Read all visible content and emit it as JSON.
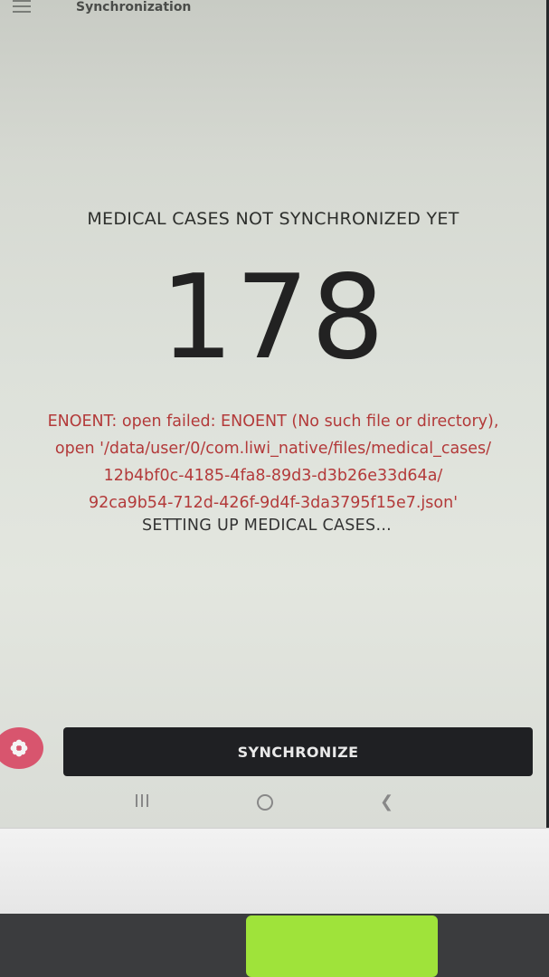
{
  "app_bar": {
    "title": "Synchronization",
    "menu_icon": "hamburger-menu-icon"
  },
  "main": {
    "not_synced_label": "MEDICAL CASES NOT SYNCHRONIZED YET",
    "count": "178",
    "error_lines": [
      "ENOENT: open failed: ENOENT (No such file or directory),",
      "open '/data/user/0/com.liwi_native/files/medical_cases/",
      "12b4bf0c-4185-4fa8-89d3-d3b26e33d64a/",
      "92ca9b54-712d-426f-9d4f-3da3795f15e7.json'"
    ],
    "status": "SETTING UP MEDICAL CASES..."
  },
  "actions": {
    "fab_icon": "flower-icon",
    "sync_label": "SYNCHRONIZE"
  },
  "navbar": {
    "recents_icon": "recents-icon",
    "home_icon": "home-icon",
    "back_icon": "back-icon"
  },
  "colors": {
    "error": "#b33a3a",
    "fab": "#d8556e",
    "button": "#1f2023"
  }
}
